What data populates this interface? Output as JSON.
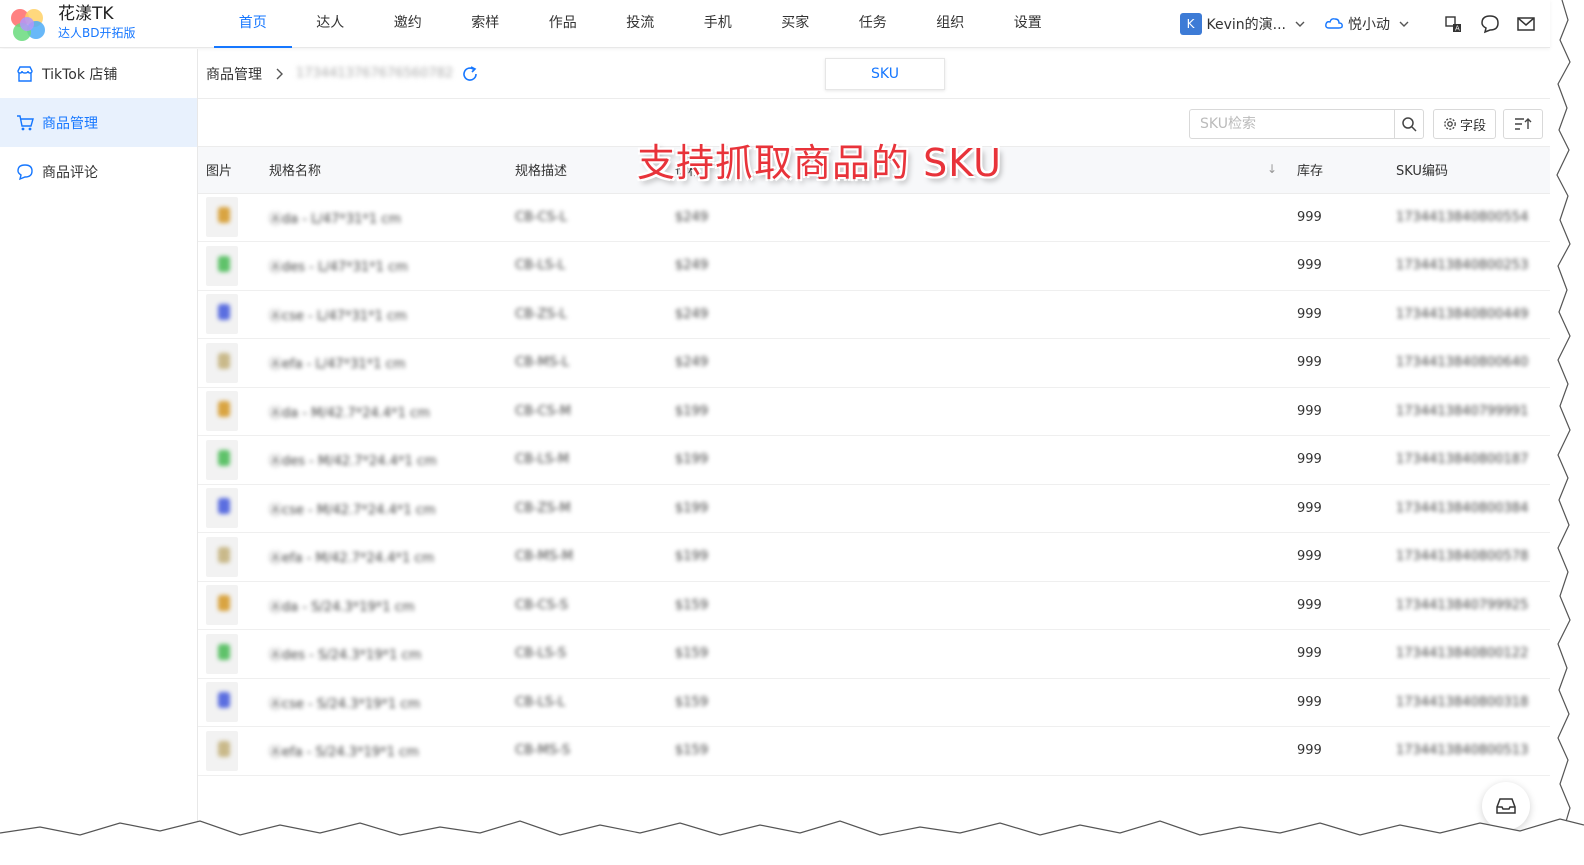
{
  "brand": {
    "name": "花漾TK",
    "subtitle": "达人BD开拓版"
  },
  "nav": [
    {
      "label": "首页",
      "active": true
    },
    {
      "label": "达人"
    },
    {
      "label": "邀约"
    },
    {
      "label": "索样"
    },
    {
      "label": "作品"
    },
    {
      "label": "投流"
    },
    {
      "label": "手机"
    },
    {
      "label": "买家"
    },
    {
      "label": "任务"
    },
    {
      "label": "组织"
    },
    {
      "label": "设置"
    }
  ],
  "account": {
    "initial": "K",
    "name": "Kevin的演...",
    "team": "悦小动"
  },
  "sidebar": [
    {
      "label": "TikTok 店铺"
    },
    {
      "label": "商品管理",
      "active": true
    },
    {
      "label": "商品评论"
    }
  ],
  "breadcrumb": {
    "first": "商品管理",
    "id": "1734413767676560782"
  },
  "tab": {
    "label": "SKU"
  },
  "search": {
    "placeholder": "SKU检索",
    "field_label": "字段"
  },
  "overlay": {
    "caption": "支持抓取商品的 SKU"
  },
  "table": {
    "headers": {
      "image": "图片",
      "spec_name": "规格名称",
      "spec_desc": "规格描述",
      "price": "价格",
      "stock": "库存",
      "sku_code": "SKU编码"
    },
    "rows": [
      {
        "color": "#d9a441",
        "name": "Ⓐda - L/47*31*1 cm",
        "desc": "CB-CS-L",
        "price": "$249",
        "stock": "999",
        "sku": "1734413840800554"
      },
      {
        "color": "#5fc26a",
        "name": "Ⓐdes - L/47*31*1 cm",
        "desc": "CB-LS-L",
        "price": "$249",
        "stock": "999",
        "sku": "1734413840800253"
      },
      {
        "color": "#5b6ee0",
        "name": "Ⓐcse - L/47*31*1 cm",
        "desc": "CB-ZS-L",
        "price": "$249",
        "stock": "999",
        "sku": "1734413840800449"
      },
      {
        "color": "#c9b98a",
        "name": "Ⓐefa - L/47*31*1 cm",
        "desc": "CB-MS-L",
        "price": "$249",
        "stock": "999",
        "sku": "1734413840800640"
      },
      {
        "color": "#d9a441",
        "name": "Ⓐda - M/42.7*24.4*1 cm",
        "desc": "CB-CS-M",
        "price": "$199",
        "stock": "999",
        "sku": "1734413840799991"
      },
      {
        "color": "#5fc26a",
        "name": "Ⓐdes - M/42.7*24.4*1 cm",
        "desc": "CB-LS-M",
        "price": "$199",
        "stock": "999",
        "sku": "1734413840800187"
      },
      {
        "color": "#5b6ee0",
        "name": "Ⓐcse - M/42.7*24.4*1 cm",
        "desc": "CB-ZS-M",
        "price": "$199",
        "stock": "999",
        "sku": "1734413840800384"
      },
      {
        "color": "#c9b98a",
        "name": "Ⓐefa - M/42.7*24.4*1 cm",
        "desc": "CB-MS-M",
        "price": "$199",
        "stock": "999",
        "sku": "1734413840800578"
      },
      {
        "color": "#d9a441",
        "name": "Ⓐda - S/24.3*19*1 cm",
        "desc": "CB-CS-S",
        "price": "$159",
        "stock": "999",
        "sku": "1734413840799925"
      },
      {
        "color": "#5fc26a",
        "name": "Ⓐdes - S/24.3*19*1 cm",
        "desc": "CB-LS-S",
        "price": "$159",
        "stock": "999",
        "sku": "1734413840800122"
      },
      {
        "color": "#5b6ee0",
        "name": "Ⓐcse - S/24.3*19*1 cm",
        "desc": "CB-LS-L",
        "price": "$159",
        "stock": "999",
        "sku": "1734413840800318"
      },
      {
        "color": "#c9b98a",
        "name": "Ⓐefa - S/24.3*19*1 cm",
        "desc": "CB-MS-S",
        "price": "$159",
        "stock": "999",
        "sku": "1734413840800513"
      }
    ]
  },
  "colors": {
    "accent": "#1677ff",
    "overlay": "#e8333a"
  }
}
